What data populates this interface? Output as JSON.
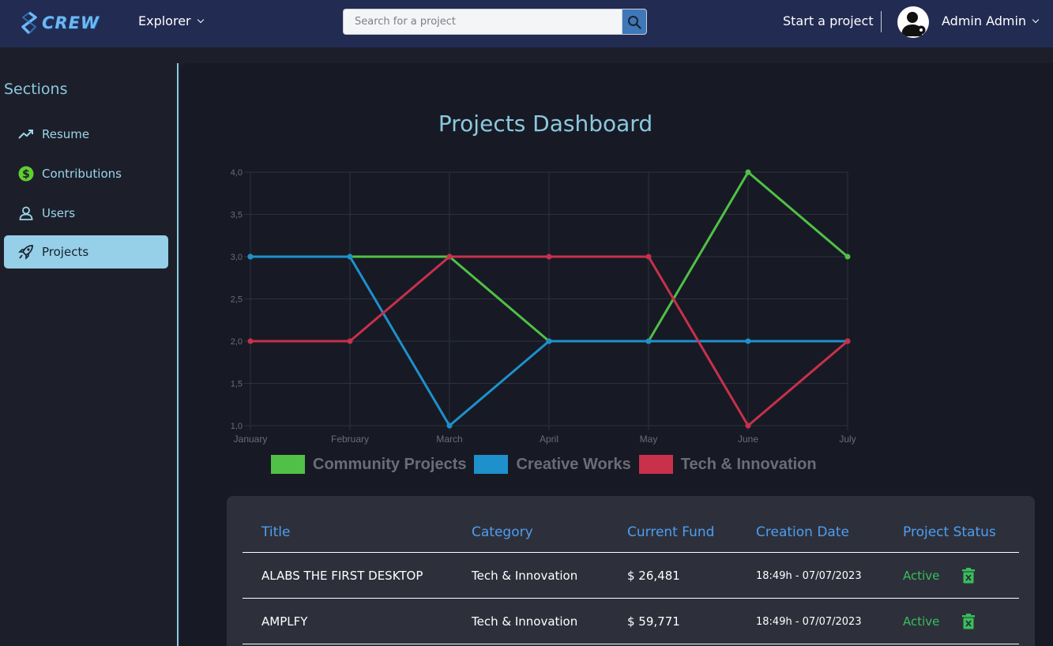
{
  "topbar": {
    "logo_text": "CREW",
    "explorer_label": "Explorer",
    "search_placeholder": "Search for a project",
    "start_project_label": "Start a project",
    "user_name": "Admin Admin"
  },
  "sidebar": {
    "title": "Sections",
    "items": [
      {
        "label": "Resume",
        "icon": "trending-up-icon"
      },
      {
        "label": "Contributions",
        "icon": "dollar-icon"
      },
      {
        "label": "Users",
        "icon": "user-icon"
      },
      {
        "label": "Projects",
        "icon": "rocket-icon",
        "active": true
      }
    ]
  },
  "main": {
    "dashboard_title": "Projects Dashboard"
  },
  "chart_data": {
    "type": "line",
    "title": "",
    "categories": [
      "January",
      "February",
      "March",
      "April",
      "May",
      "June",
      "July"
    ],
    "y_ticks": [
      "1,0",
      "1,5",
      "2,0",
      "2,5",
      "3,0",
      "3,5",
      "4,0"
    ],
    "ylim": [
      1,
      4
    ],
    "grid": true,
    "legend_position": "bottom",
    "series": [
      {
        "name": "Community Projects",
        "color": "#50c046",
        "values": [
          3,
          3,
          3,
          2,
          2,
          4,
          3
        ]
      },
      {
        "name": "Creative Works",
        "color": "#1e90cc",
        "values": [
          3,
          3,
          1,
          2,
          2,
          2,
          2
        ]
      },
      {
        "name": "Tech & Innovation",
        "color": "#c8304c",
        "values": [
          2,
          2,
          3,
          3,
          3,
          1,
          2
        ]
      }
    ]
  },
  "table": {
    "headers": {
      "title": "Title",
      "category": "Category",
      "fund": "Current Fund",
      "date": "Creation Date",
      "status": "Project Status"
    },
    "rows": [
      {
        "title": "ALABS THE FIRST DESKTOP",
        "category": "Tech & Innovation",
        "fund": "$ 26,481",
        "date": "18:49h - 07/07/2023",
        "status": "Active"
      },
      {
        "title": "AMPLFY",
        "category": "Tech & Innovation",
        "fund": "$ 59,771",
        "date": "18:49h - 07/07/2023",
        "status": "Active"
      }
    ]
  }
}
